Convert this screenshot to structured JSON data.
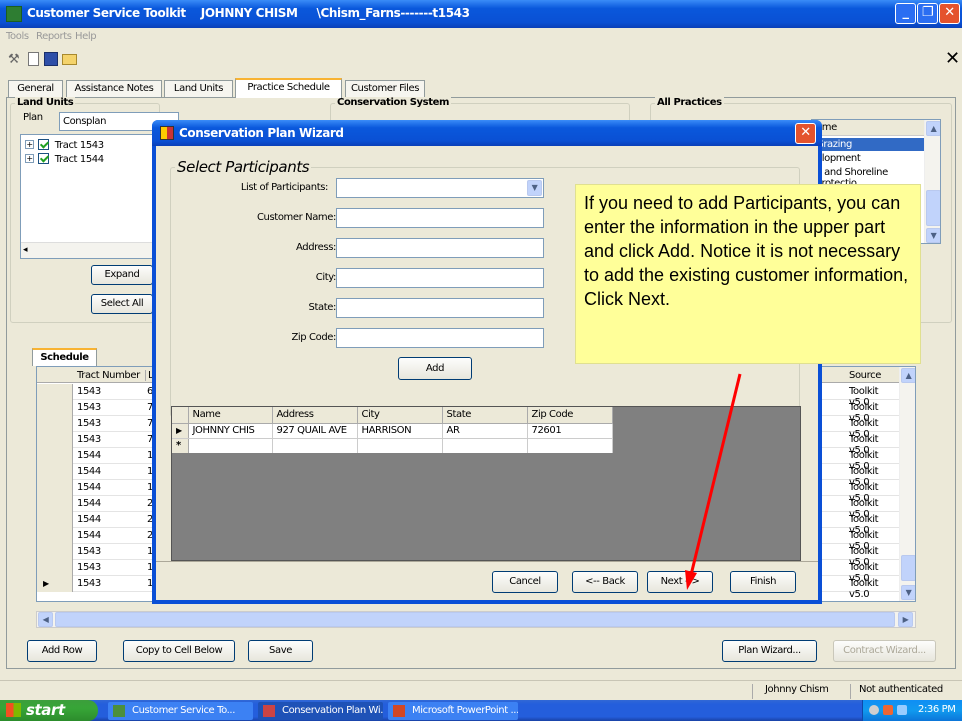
{
  "window": {
    "title": "Customer Service Toolkit    JOHNNY CHISM     \\Chism_Farns-------t1543",
    "menu": [
      "Tools",
      "Reports",
      "Help"
    ]
  },
  "tabs": [
    "General",
    "Assistance Notes",
    "Land Units",
    "Practice Schedule",
    "Customer Files"
  ],
  "land_units": {
    "title": "Land Units",
    "plan_label": "Plan",
    "plan_value": "Consplan",
    "tree": [
      {
        "label": "Tract 1543",
        "expand": "+"
      },
      {
        "label": "Tract 1544",
        "expand": "+"
      }
    ],
    "expand_label": "Expand",
    "select_all_label": "Select All"
  },
  "conservation_system": {
    "title": "Conservation System"
  },
  "all_practices": {
    "title": "All Practices",
    "header": "ame",
    "items": [
      "Grazing",
      "elopment",
      "k and Shoreline Protectio"
    ]
  },
  "schedule": {
    "tab_label": "Schedule",
    "col_tract": "Tract Number",
    "col_l": "L",
    "col_source": "Source",
    "rows": [
      {
        "tract": "1543",
        "l": "6",
        "source": "Toolkit v5.0"
      },
      {
        "tract": "1543",
        "l": "7",
        "source": "Toolkit v5.0"
      },
      {
        "tract": "1543",
        "l": "7",
        "source": "Toolkit v5.0"
      },
      {
        "tract": "1543",
        "l": "7",
        "source": "Toolkit v5.0"
      },
      {
        "tract": "1544",
        "l": "1",
        "source": "Toolkit v5.0"
      },
      {
        "tract": "1544",
        "l": "1",
        "source": "Toolkit v5.0"
      },
      {
        "tract": "1544",
        "l": "1",
        "source": "Toolkit v5.0"
      },
      {
        "tract": "1544",
        "l": "2",
        "source": "Toolkit v5.0"
      },
      {
        "tract": "1544",
        "l": "2",
        "source": "Toolkit v5.0"
      },
      {
        "tract": "1544",
        "l": "2",
        "source": "Toolkit v5.0"
      },
      {
        "tract": "1543",
        "l": "1",
        "source": "Toolkit v5.0"
      },
      {
        "tract": "1543",
        "l": "1",
        "source": "Toolkit v5.0"
      },
      {
        "tract": "1543",
        "l": "1",
        "source": "Toolkit v5.0"
      }
    ]
  },
  "bottom_buttons": {
    "add_row": "Add Row",
    "copy_cell": "Copy to Cell Below",
    "save": "Save",
    "plan_wizard": "Plan Wizard...",
    "contract_wizard": "Contract Wizard..."
  },
  "status_bar": {
    "user": "Johnny Chism",
    "auth": "Not authenticated"
  },
  "dialog": {
    "title": "Conservation Plan Wizard",
    "section_title": "Select Participants",
    "fields": {
      "list_label": "List of Participants:",
      "name_label": "Customer Name:",
      "address_label": "Address:",
      "city_label": "City:",
      "state_label": "State:",
      "zip_label": "Zip Code:"
    },
    "add_label": "Add",
    "grid_headers": [
      "Name",
      "Address",
      "City",
      "State",
      "Zip Code"
    ],
    "grid_row": [
      "JOHNNY CHIS",
      "927 QUAIL AVE",
      "HARRISON",
      "AR",
      "72601"
    ],
    "new_row_marker": "*",
    "current_row_marker": "▶",
    "buttons": {
      "cancel": "Cancel",
      "back": "<-- Back",
      "next": "Next -->",
      "finish": "Finish"
    }
  },
  "callout": {
    "text": "If you need to add Participants, you can enter the information in the upper part and click Add. Notice it is not necessary to add the existing customer information, Click Next."
  },
  "taskbar": {
    "start": "start",
    "items": [
      "Customer Service To...",
      "Conservation Plan Wi...",
      "Microsoft PowerPoint ..."
    ],
    "clock": "2:36 PM"
  },
  "colors": {
    "titlebar": "#0a58dc",
    "callout_bg": "#ffff99",
    "arrow": "#ff0000",
    "selection": "#316ac5"
  },
  "icons": [
    "app-icon",
    "wrench-icon",
    "new-icon",
    "save-icon",
    "open-icon",
    "close-x-icon",
    "windows-logo-icon",
    "arrow"
  ]
}
